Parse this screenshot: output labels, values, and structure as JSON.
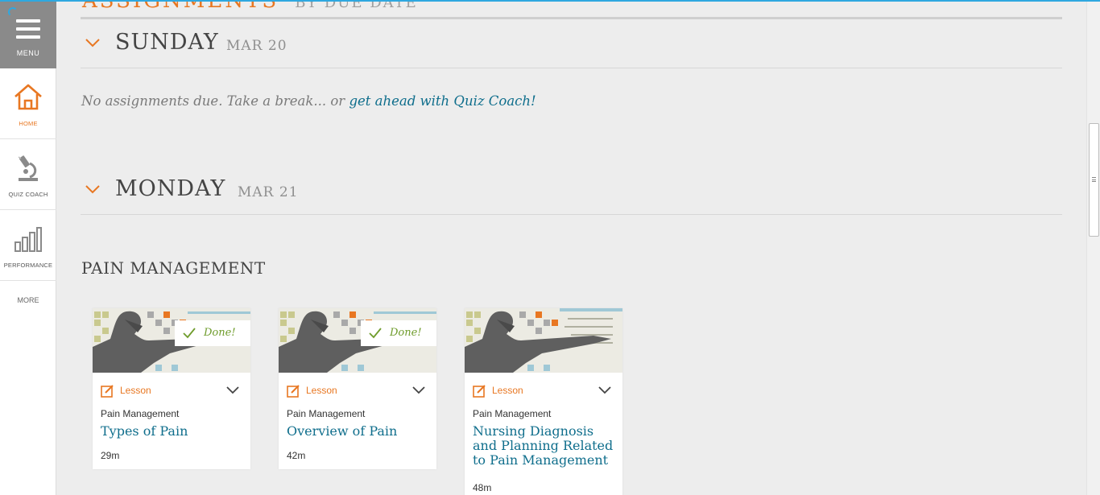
{
  "sidebar": {
    "menu_label": "MENU",
    "items": [
      {
        "label": "HOME",
        "icon": "home-icon",
        "active": true
      },
      {
        "label": "QUIZ COACH",
        "icon": "microscope-icon",
        "active": false
      },
      {
        "label": "PERFORMANCE",
        "icon": "bar-chart-icon",
        "active": false
      }
    ],
    "more_label": "MORE"
  },
  "header": {
    "title": "ASSIGNMENTS",
    "subtitle": "BY DUE DATE"
  },
  "days": [
    {
      "day": "SUNDAY",
      "date": "MAR 20"
    },
    {
      "day": "MONDAY",
      "date": "MAR 21"
    }
  ],
  "empty_message": {
    "prefix": "No assignments due. Take a break... or ",
    "link": "get ahead with Quiz Coach!"
  },
  "section": {
    "title": "PAIN MANAGEMENT"
  },
  "cards": [
    {
      "type": "Lesson",
      "course": "Pain Management",
      "title": "Types of Pain",
      "duration": "29m",
      "status": "Done!"
    },
    {
      "type": "Lesson",
      "course": "Pain Management",
      "title": "Overview of Pain",
      "duration": "42m",
      "status": "Done!"
    },
    {
      "type": "Lesson",
      "course": "Pain Management",
      "title": "Nursing Diagnosis and Planning Related to Pain Management",
      "duration": "48m",
      "status": ""
    }
  ],
  "colors": {
    "accent": "#e87722",
    "link": "#0f6e8c",
    "done": "#6f9c2c",
    "menu_bg": "#8a8a8a"
  }
}
